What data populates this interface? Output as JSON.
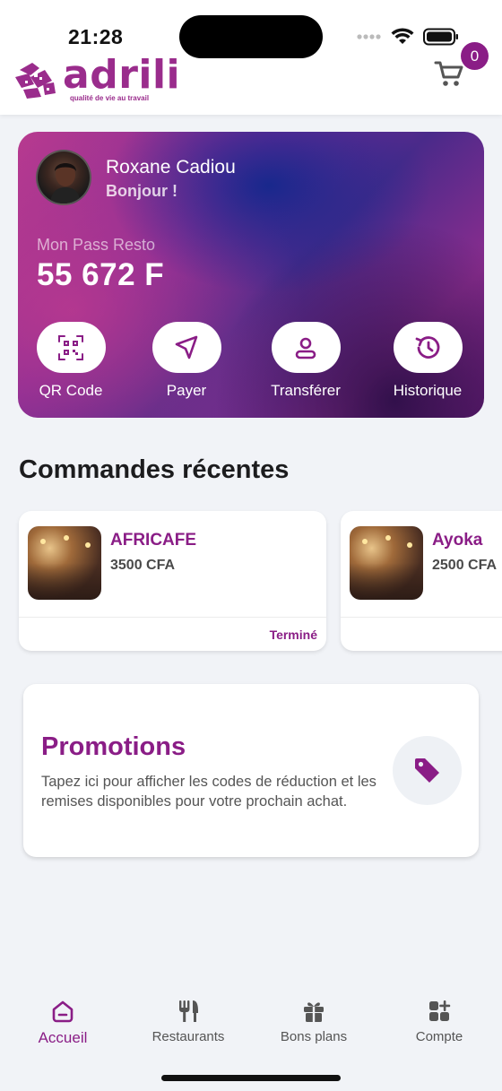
{
  "status_bar": {
    "time": "21:28"
  },
  "brand": {
    "name": "adrili",
    "tagline": "qualité de vie au travail",
    "color": "#9a2c8c"
  },
  "cart": {
    "icon": "cart-icon",
    "count": "0"
  },
  "account": {
    "user_name": "Roxane Cadiou",
    "greeting": "Bonjour !",
    "pass_label": "Mon Pass Resto",
    "pass_amount": "55 672 F"
  },
  "actions": [
    {
      "label": "QR Code",
      "icon": "qr-code-icon"
    },
    {
      "label": "Payer",
      "icon": "send-arrow-icon"
    },
    {
      "label": "Transférer",
      "icon": "user-icon"
    },
    {
      "label": "Historique",
      "icon": "history-icon"
    }
  ],
  "recent_orders": {
    "title": "Commandes récentes",
    "items": [
      {
        "name": "AFRICAFE",
        "price": "3500 CFA",
        "status": "Terminé"
      },
      {
        "name": "Ayoka",
        "price": "2500 CFA",
        "status": ""
      }
    ]
  },
  "promotions": {
    "title": "Promotions",
    "description": "Tapez ici pour afficher les codes de réduction et les remises disponibles pour votre prochain achat.",
    "icon": "tag-icon"
  },
  "bottom_nav": [
    {
      "label": "Accueil",
      "icon": "home-icon",
      "active": true
    },
    {
      "label": "Restaurants",
      "icon": "cutlery-icon",
      "active": false
    },
    {
      "label": "Bons plans",
      "icon": "gift-icon",
      "active": false
    },
    {
      "label": "Compte",
      "icon": "apps-plus-icon",
      "active": false
    }
  ],
  "colors": {
    "accent": "#8a1d86",
    "background": "#f1f3f7"
  }
}
